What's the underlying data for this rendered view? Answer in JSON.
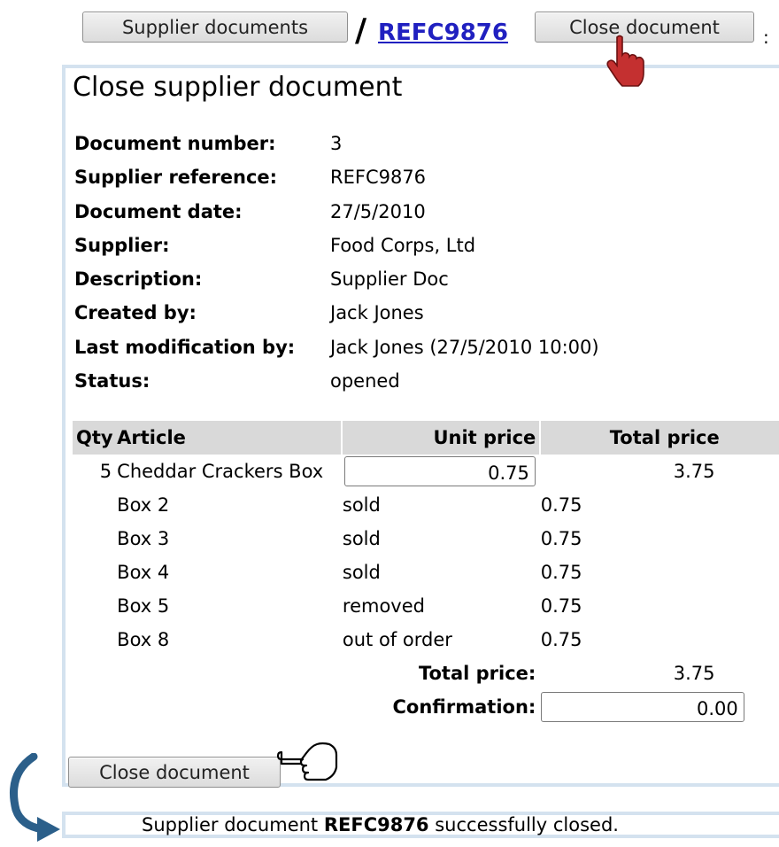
{
  "toolbar": {
    "supplier_documents_label": "Supplier documents",
    "separator": "/",
    "reference_link": "REFC9876",
    "close_document_label": "Close document",
    "trailing": ":"
  },
  "panel": {
    "title": "Close supplier document",
    "fields": [
      {
        "label": "Document number:",
        "value": "3"
      },
      {
        "label": "Supplier reference:",
        "value": "REFC9876"
      },
      {
        "label": "Document date:",
        "value": "27/5/2010"
      },
      {
        "label": "Supplier:",
        "value": "Food Corps, Ltd"
      },
      {
        "label": "Description:",
        "value": "Supplier Doc"
      },
      {
        "label": "Created by:",
        "value": "Jack Jones"
      },
      {
        "label": "Last modification by:",
        "value": "Jack Jones (27/5/2010 10:00)"
      },
      {
        "label": "Status:",
        "value": "opened"
      }
    ],
    "table": {
      "headers": [
        "Qty",
        "Article",
        "Unit price",
        "Total price"
      ],
      "line": {
        "qty": "5",
        "article": "Cheddar Crackers Box",
        "unit_price": "0.75",
        "total_price": "3.75"
      },
      "boxes": [
        {
          "name": "Box 2",
          "status": "sold",
          "price": "0.75"
        },
        {
          "name": "Box 3",
          "status": "sold",
          "price": "0.75"
        },
        {
          "name": "Box 4",
          "status": "sold",
          "price": "0.75"
        },
        {
          "name": "Box 5",
          "status": "removed",
          "price": "0.75"
        },
        {
          "name": "Box 8",
          "status": "out of order",
          "price": "0.75"
        }
      ],
      "total_label": "Total price:",
      "total_value": "3.75",
      "confirmation_label": "Confirmation:",
      "confirmation_value": "0.00"
    },
    "close_button_label": "Close document"
  },
  "message": {
    "prefix": "Supplier document ",
    "reference": "REFC9876",
    "suffix": " successfully closed."
  },
  "colors": {
    "panel_border": "#d4e2ef",
    "header_bg": "#d9d9d9",
    "link": "#2020c0",
    "hand_cursor": "#c43030",
    "arrow": "#2b5f8a"
  }
}
